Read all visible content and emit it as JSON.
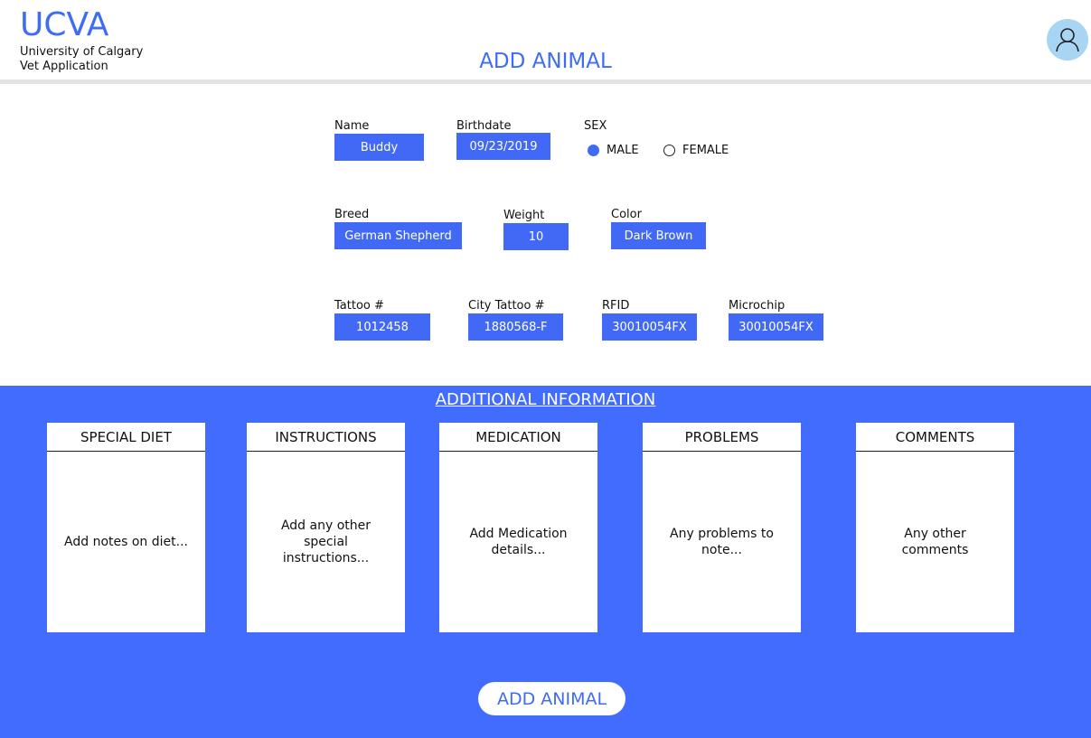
{
  "header": {
    "logo": "UCVA",
    "subtitle_line1": "University of Calgary",
    "subtitle_line2": "Vet Application",
    "page_title": "ADD ANIMAL",
    "avatar_icon": "user-icon"
  },
  "form": {
    "name": {
      "label": "Name",
      "value": "Buddy"
    },
    "birthdate": {
      "label": "Birthdate",
      "value": "09/23/2019"
    },
    "sex": {
      "label": "SEX",
      "options": [
        "MALE",
        "FEMALE"
      ],
      "selected": "MALE"
    },
    "breed": {
      "label": "Breed",
      "value": "German Shepherd"
    },
    "weight": {
      "label": "Weight",
      "value": "10"
    },
    "color": {
      "label": "Color",
      "value": "Dark Brown"
    },
    "tattoo": {
      "label": "Tattoo #",
      "value": "1012458"
    },
    "city_tattoo": {
      "label": "City Tattoo #",
      "value": "1880568-F"
    },
    "rfid": {
      "label": "RFID",
      "value": "30010054FX"
    },
    "microchip": {
      "label": "Microchip",
      "value": "30010054FX"
    }
  },
  "additional": {
    "title": "ADDITIONAL INFORMATION",
    "cards": [
      {
        "title": "SPECIAL DIET",
        "placeholder": "Add notes on diet..."
      },
      {
        "title": "INSTRUCTIONS",
        "placeholder": "Add any other special instructions..."
      },
      {
        "title": "MEDICATION",
        "placeholder": "Add Medication details..."
      },
      {
        "title": "PROBLEMS",
        "placeholder": "Any problems to note..."
      },
      {
        "title": "COMMENTS",
        "placeholder": "Any other comments"
      }
    ]
  },
  "actions": {
    "add_label": "ADD ANIMAL"
  },
  "colors": {
    "accent": "#3f6cf5",
    "panel": "#426cfd",
    "avatar_bg": "#a9d5f5"
  }
}
